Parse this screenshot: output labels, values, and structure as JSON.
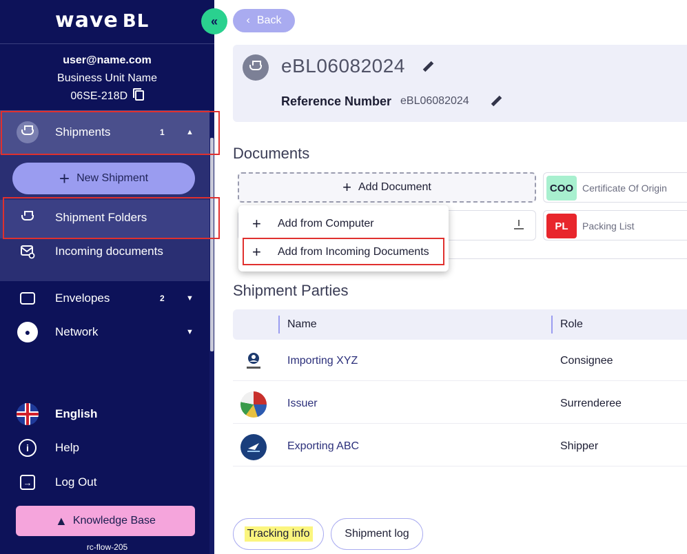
{
  "brand": {
    "logo_main": "wave",
    "logo_suffix": "BL"
  },
  "user": {
    "email": "user@name.com",
    "business_unit": "Business Unit Name",
    "id": "06SE-218D"
  },
  "sidebar": {
    "shipments": {
      "label": "Shipments",
      "count": "1"
    },
    "new_shipment_label": "New Shipment",
    "shipment_folders_label": "Shipment Folders",
    "incoming_documents_label": "Incoming documents",
    "envelopes": {
      "label": "Envelopes",
      "count": "2"
    },
    "network_label": "Network",
    "language_label": "English",
    "help_label": "Help",
    "logout_label": "Log Out",
    "knowledge_base_label": "Knowledge Base",
    "version": "rc-flow-205"
  },
  "main": {
    "back_label": "Back",
    "shipment_title": "eBL06082024",
    "reference_label": "Reference Number",
    "reference_value": "eBL06082024",
    "documents_title": "Documents",
    "add_document_label": "Add Document",
    "add_menu": {
      "from_computer": "Add from Computer",
      "from_incoming": "Add from Incoming Documents"
    },
    "doc_chips": [
      {
        "tag": "COO",
        "label": "Certificate Of Origin",
        "tag_color": "#a8f0cf"
      },
      {
        "tag": "PL",
        "label": "Packing List",
        "tag_color": "#e8262c"
      }
    ],
    "parties_title": "Shipment Parties",
    "parties_columns": {
      "name": "Name",
      "role": "Role"
    },
    "parties": [
      {
        "name": "Importing XYZ",
        "role": "Consignee"
      },
      {
        "name": "Issuer",
        "role": "Surrenderee"
      },
      {
        "name": "Exporting ABC",
        "role": "Shipper"
      }
    ],
    "tracking_info_label": "Tracking info",
    "shipment_log_label": "Shipment log"
  },
  "colors": {
    "sidebar_bg": "#0d1259",
    "accent": "#9a9cf0",
    "collapse_button": "#2ad18f",
    "knowledge_base": "#f5a5dc",
    "highlight_box": "#e0302e"
  }
}
